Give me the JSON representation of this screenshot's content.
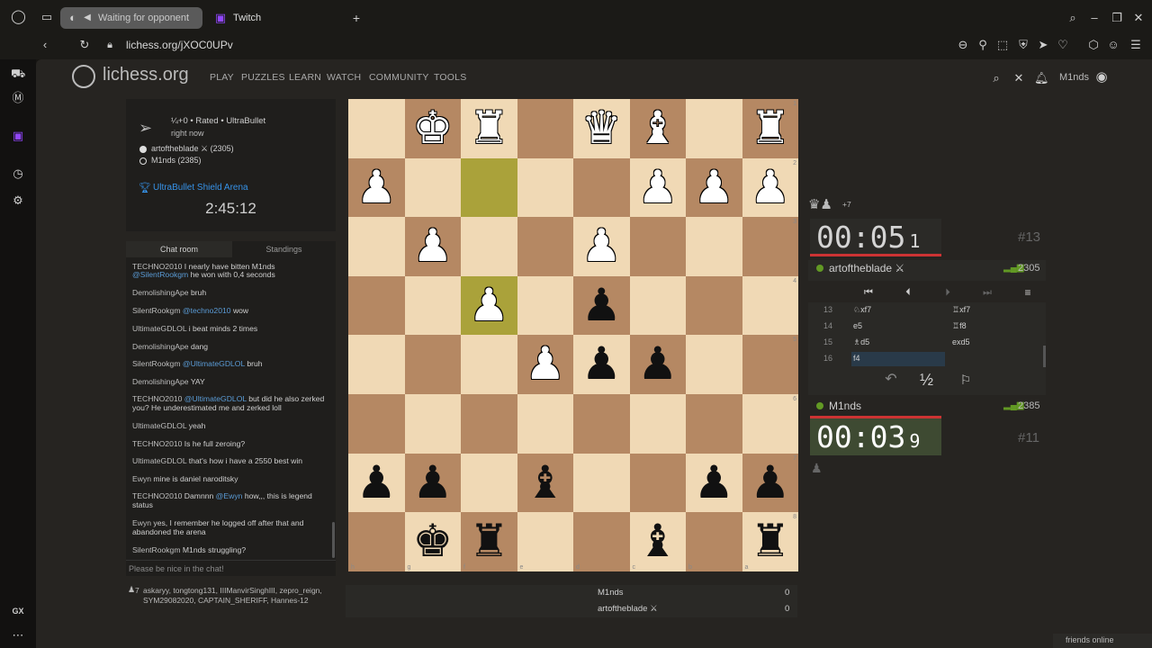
{
  "browser": {
    "tabs": [
      {
        "label": "Waiting for opponent",
        "active": true
      },
      {
        "label": "Twitch",
        "active": false
      }
    ],
    "url": "lichess.org/jXOC0UPv",
    "new_tab": "+"
  },
  "site": {
    "logo": "lichess.org",
    "nav": [
      "PLAY",
      "PUZZLES",
      "LEARN",
      "WATCH",
      "COMMUNITY",
      "TOOLS"
    ],
    "user": "M1nds"
  },
  "game_info": {
    "mode": "¼+0 • Rated • UltraBullet",
    "time": "right now",
    "white_player": "artoftheblade ⚔ (2305)",
    "black_player": "M1nds (2385)",
    "tournament": "UltraBullet Shield Arena",
    "tournament_clock": "2:45:12"
  },
  "chat": {
    "tabs": [
      "Chat room",
      "Standings"
    ],
    "placeholder": "Please be nice in the chat!",
    "lines": [
      {
        "user": "TECHNO2010",
        "text": "I nearly have bitten M1nds",
        "mention": "",
        "text2": ""
      },
      {
        "user": "",
        "text": "",
        "mention": "@SilentRookgm",
        "text2": "he won with 0,4 seconds"
      },
      {
        "user": "DemolishingApe",
        "text": "bruh",
        "mention": "",
        "text2": ""
      },
      {
        "user": "SilentRookgm",
        "text": "",
        "mention": "@techno2010",
        "text2": "wow"
      },
      {
        "user": "UltimateGDLOL",
        "text": "i beat minds 2 times",
        "mention": "",
        "text2": ""
      },
      {
        "user": "DemolishingApe",
        "text": "dang",
        "mention": "",
        "text2": ""
      },
      {
        "user": "SilentRookgm",
        "text": "",
        "mention": "@UltimateGDLOL",
        "text2": "bruh"
      },
      {
        "user": "DemolishingApe",
        "text": "YAY",
        "mention": "",
        "text2": ""
      },
      {
        "user": "TECHNO2010",
        "text": "",
        "mention": "@UltimateGDLOL",
        "text2": "but did he also zerked"
      },
      {
        "user": "",
        "text": "you? He underestimated me and zerked loll",
        "mention": "",
        "text2": ""
      },
      {
        "user": "UltimateGDLOL",
        "text": "yeah",
        "mention": "",
        "text2": ""
      },
      {
        "user": "TECHNO2010",
        "text": "Is he full zeroing?",
        "mention": "",
        "text2": ""
      },
      {
        "user": "UltimateGDLOL",
        "text": "that's how i have a 2550 best win",
        "mention": "",
        "text2": ""
      },
      {
        "user": "Ewyn",
        "text": "mine is daniel naroditsky",
        "mention": "",
        "text2": ""
      },
      {
        "user": "TECHNO2010",
        "text": "Damnnn",
        "mention": "@Ewyn",
        "text2": "how,,, this is legend"
      },
      {
        "user": "",
        "text": "status",
        "mention": "",
        "text2": ""
      },
      {
        "user": "Ewyn",
        "text": "yes, I remember he logged off after that and",
        "mention": "",
        "text2": ""
      },
      {
        "user": "",
        "text": "abandoned the arena",
        "mention": "",
        "text2": ""
      },
      {
        "user": "SilentRookgm",
        "text": "M1nds struggling?",
        "mention": "",
        "text2": ""
      }
    ]
  },
  "spectators": {
    "count": "7",
    "names_line1": "askaryy, tongtong131, IIIManvirSinghIII, zepro_reign,",
    "names_line2": "SYM29082020, CAPTAIN_SHERIFF, Hannes-12"
  },
  "board": {
    "ranks": [
      "1",
      "2",
      "3",
      "4",
      "5",
      "6",
      "7",
      "8"
    ],
    "files": [
      "h",
      "g",
      "f",
      "e",
      "d",
      "c",
      "b",
      "a"
    ],
    "highlight": [
      [
        2,
        1
      ],
      [
        2,
        3
      ]
    ],
    "pieces": [
      [
        1,
        0,
        "w",
        "♚"
      ],
      [
        2,
        0,
        "w",
        "♜"
      ],
      [
        4,
        0,
        "w",
        "♛"
      ],
      [
        5,
        0,
        "w",
        "♝"
      ],
      [
        7,
        0,
        "w",
        "♜"
      ],
      [
        0,
        1,
        "w",
        "♟"
      ],
      [
        5,
        1,
        "w",
        "♟"
      ],
      [
        6,
        1,
        "w",
        "♟"
      ],
      [
        7,
        1,
        "w",
        "♟"
      ],
      [
        1,
        2,
        "w",
        "♟"
      ],
      [
        4,
        2,
        "w",
        "♟"
      ],
      [
        2,
        3,
        "w",
        "♟"
      ],
      [
        4,
        3,
        "b",
        "♟"
      ],
      [
        3,
        4,
        "w",
        "♟"
      ],
      [
        4,
        4,
        "b",
        "♟"
      ],
      [
        5,
        4,
        "b",
        "♟"
      ],
      [
        0,
        6,
        "b",
        "♟"
      ],
      [
        1,
        6,
        "b",
        "♟"
      ],
      [
        3,
        6,
        "b",
        "♝"
      ],
      [
        6,
        6,
        "b",
        "♟"
      ],
      [
        7,
        6,
        "b",
        "♟"
      ],
      [
        1,
        7,
        "b",
        "♚"
      ],
      [
        2,
        7,
        "b",
        "♜"
      ],
      [
        5,
        7,
        "b",
        "♝"
      ],
      [
        7,
        7,
        "b",
        "♜"
      ]
    ]
  },
  "right": {
    "material": "+7",
    "top_clock": {
      "main": "00:05",
      "tenth": "1"
    },
    "top_rank": "#13",
    "top_player": "artoftheblade ⚔",
    "top_rating": "2305",
    "moves": [
      {
        "n": "13",
        "w": "♘xf7",
        "b": "♖xf7"
      },
      {
        "n": "14",
        "w": "e5",
        "b": "♖f8"
      },
      {
        "n": "15",
        "w": "♗d5",
        "b": "exd5"
      },
      {
        "n": "16",
        "w": "f4",
        "b": ""
      }
    ],
    "draw": "½",
    "bottom_player": "M1nds",
    "bottom_rating": "2385",
    "bottom_clock": {
      "main": "00:03",
      "tenth": "9"
    },
    "bottom_rank": "#11"
  },
  "scores": [
    {
      "name": "M1nds",
      "score": "0"
    },
    {
      "name": "artoftheblade ⚔",
      "score": "0"
    }
  ],
  "friends": "friends online",
  "colors": {
    "accent": "#3692e7",
    "highlight": "#aaa23a",
    "light_sq": "#f0d9b5",
    "dark_sq": "#b58863",
    "online": "#629924"
  }
}
